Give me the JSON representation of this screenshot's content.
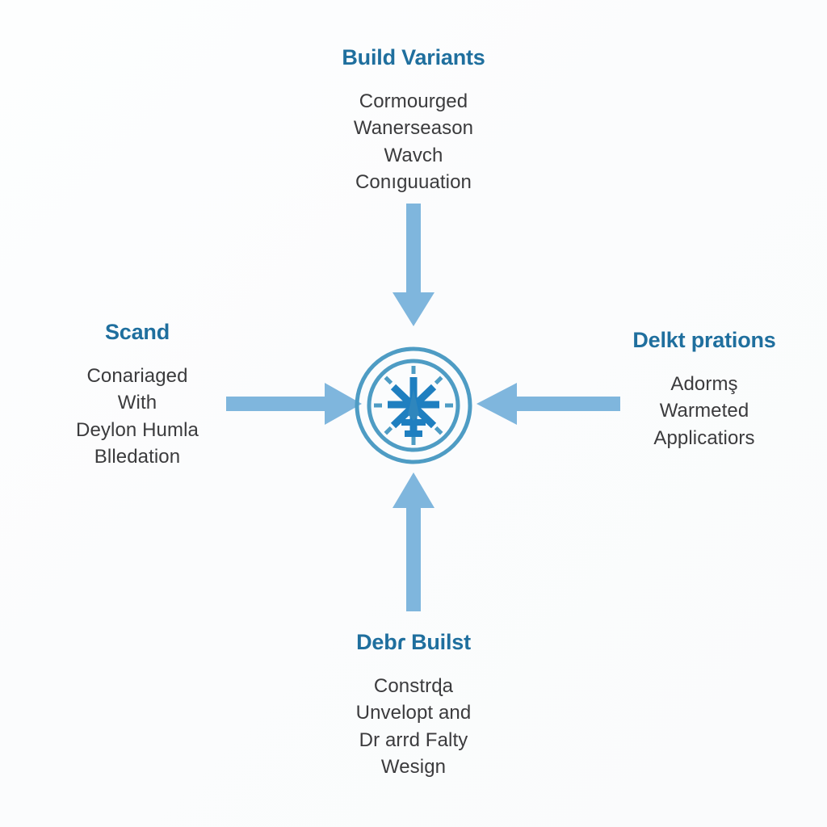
{
  "diagram": {
    "type": "hub-and-spoke",
    "background_color": "#fcfdfd",
    "title_color": "#1f6f9e",
    "body_color": "#3b3b3d",
    "arrow_color": "#7fb6dd",
    "hub_color": "#2f86bd",
    "hub_icon": "compass-dial-icon",
    "center": {
      "icon_name": "compass-dial-icon",
      "outer_ring_color": "#4e9cc4",
      "inner_ring_color": "#4e9cc4",
      "spoke_color": "#1f7fc0"
    },
    "nodes": [
      {
        "position": "top",
        "title": "Build Variants",
        "lines": [
          "Cormourged",
          "Wanerseason",
          "Wavch",
          "Conıguuation"
        ],
        "arrow": {
          "name": "arrow-down",
          "direction": "down"
        }
      },
      {
        "position": "left",
        "title": "Scand",
        "lines": [
          "Conariaged",
          "With",
          "Deylon Humla",
          "Blledation"
        ],
        "arrow": {
          "name": "arrow-right",
          "direction": "right"
        }
      },
      {
        "position": "right",
        "title": "Delkt prations",
        "lines": [
          "Adormş",
          "Warmeted",
          "Applicatiors"
        ],
        "arrow": {
          "name": "arrow-left",
          "direction": "left"
        }
      },
      {
        "position": "bottom",
        "title": "Debɾ Builst",
        "lines": [
          "Constrɖa",
          "Unvelopt and",
          "Dr arrd Falty",
          "Wesign"
        ],
        "arrow": {
          "name": "arrow-up",
          "direction": "up"
        }
      }
    ]
  }
}
